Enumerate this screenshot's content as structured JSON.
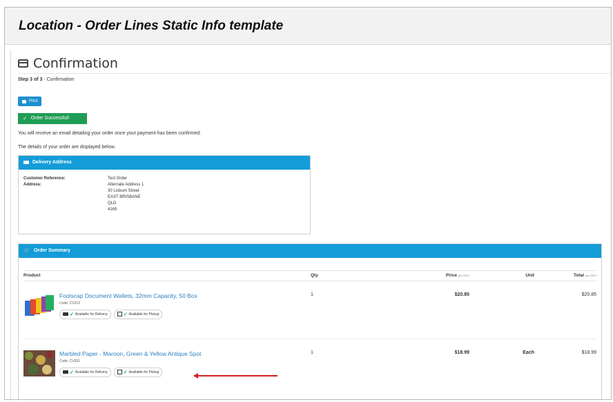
{
  "window_title": "Location - Order Lines Static Info template",
  "page_title": "Confirmation",
  "step": {
    "label": "Step 3 of 3",
    "suffix": " - Confirmation"
  },
  "print_label": "Print",
  "success_label": "Order Successful!",
  "notes": [
    "You will receive an email detailing your order once your payment has been confirmed.",
    "The details of your order are displayed below."
  ],
  "delivery": {
    "title": "Delivery Address",
    "customer_reference_label": "Customer Reference:",
    "customer_reference": "Test Order",
    "address_label": "Address:",
    "address_lines": [
      "Alternate Address 1",
      "30 Lisburn Street",
      "EAST BRISBANE",
      "QLD",
      "4169"
    ]
  },
  "summary": {
    "title": "Order Summary",
    "columns": {
      "product": "Product",
      "qty": "Qty",
      "price": "Price",
      "price_note": "(ex GST)",
      "unit": "Unit",
      "total": "Total",
      "total_note": "(ex GST)"
    },
    "delivery_badge": "Available for Delivery",
    "pickup_badge": "Available for Pickup",
    "items": [
      {
        "name": "Foolscap Document Wallets, 32mm Capacity, 50 Box",
        "code": "Code: CV312",
        "qty": "1",
        "price": "$20.85",
        "unit": "",
        "total": "$20.85"
      },
      {
        "name": "Marbled Paper - Maroon, Green & Yellow Antique Spot",
        "code": "Code: CV351",
        "qty": "1",
        "price": "$18.99",
        "unit": "Each",
        "total": "$18.99"
      }
    ]
  },
  "colors": {
    "panel_header": "#139cd8",
    "success": "#1f9d55",
    "print_button": "#1f8fd0",
    "link": "#2a7fc0",
    "arrow": "#d21f1f"
  }
}
